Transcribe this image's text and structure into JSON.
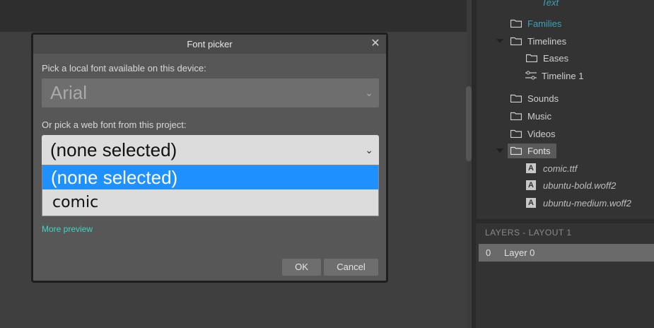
{
  "project_tree": {
    "text_partial": "Text",
    "families": "Families",
    "timelines": "Timelines",
    "eases": "Eases",
    "timeline1": "Timeline 1",
    "sounds": "Sounds",
    "music": "Music",
    "videos": "Videos",
    "fonts": "Fonts",
    "font_files": [
      "comic.ttf",
      "ubuntu-bold.woff2",
      "ubuntu-medium.woff2"
    ],
    "font_icon_glyph": "A"
  },
  "layers": {
    "header": "LAYERS - LAYOUT 1",
    "rows": [
      {
        "index": "0",
        "name": "Layer 0"
      }
    ]
  },
  "dialog": {
    "title": "Font picker",
    "close_glyph": "✕",
    "local_label": "Pick a local font available on this device:",
    "local_value": "Arial",
    "web_label": "Or pick a web font from this project:",
    "web_value": "(none selected)",
    "options": [
      "(none selected)",
      "comic"
    ],
    "more_preview": "More preview",
    "ok": "OK",
    "cancel": "Cancel"
  },
  "colors": {
    "accent_link": "#3fd6c0",
    "selection_blue": "#1e90ff",
    "teal_folder": "#3aa3b5"
  }
}
